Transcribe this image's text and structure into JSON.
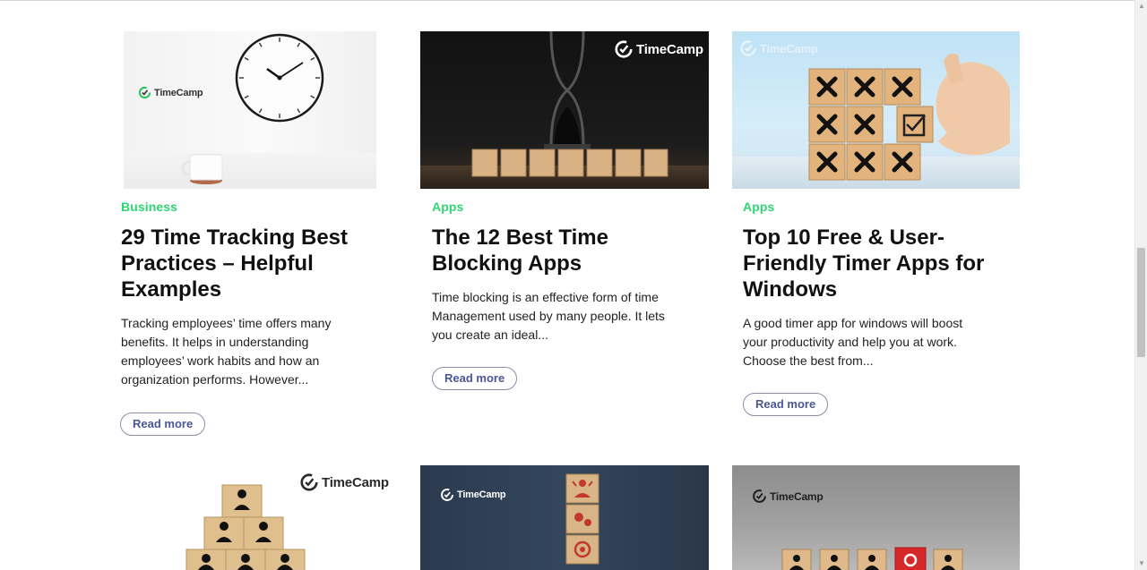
{
  "brand": {
    "name": "TimeCamp"
  },
  "colors": {
    "category": "#2ed573",
    "read_more": "#4a5795",
    "accent_red": "#d62828"
  },
  "posts": [
    {
      "category": "Business",
      "title_lines": [
        "29 Time Tracking Best",
        "Practices – Helpful",
        "Examples"
      ],
      "excerpt_lines": [
        "Tracking employees’ time offers many",
        "benefits. It helps in understanding",
        "employees’ work habits and how an",
        "organization performs. However..."
      ],
      "read_more": "Read more",
      "image": "clock-and-coffee-mug"
    },
    {
      "category": "Apps",
      "title_lines": [
        "The 12 Best Time",
        "Blocking Apps"
      ],
      "excerpt_lines": [
        "Time blocking is an effective form of time",
        "Management used by many people. It lets",
        "you create an ideal..."
      ],
      "read_more": "Read more",
      "image": "hourglass-on-wooden-blocks"
    },
    {
      "category": "Apps",
      "title_lines": [
        "Top 10 Free & User-",
        "Friendly Timer Apps for",
        "Windows"
      ],
      "excerpt_lines": [
        "A good timer app for windows will boost",
        "your productivity and help you at work.",
        "Choose the best from..."
      ],
      "read_more": "Read more",
      "image": "tic-tac-toe-blocks-hand"
    }
  ],
  "posts_row2": [
    {
      "image": "pyramid-people-blocks"
    },
    {
      "image": "stacked-icon-blocks"
    },
    {
      "image": "row-of-people-blocks"
    }
  ]
}
